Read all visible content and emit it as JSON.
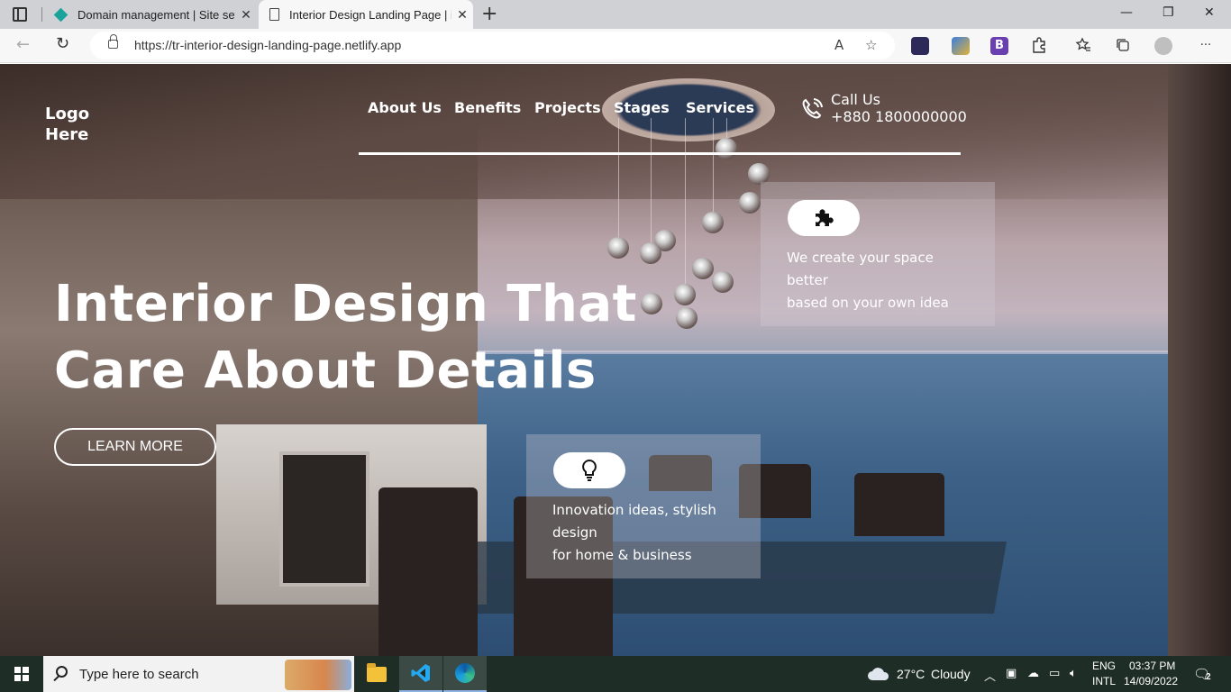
{
  "browser": {
    "tabs": [
      {
        "title": "Domain management | Site settin",
        "close": "✕"
      },
      {
        "title": "Interior Design Landing Page | iN",
        "close": "✕"
      }
    ],
    "new_tab": "+",
    "window_controls": {
      "minimize": "—",
      "restore": "❐",
      "close": "✕"
    },
    "back": "←",
    "reload": "↻",
    "url": "https://tr-interior-design-landing-page.netlify.app",
    "read_aloud": "A",
    "favorite": "☆",
    "more": "···",
    "extensions": {
      "b_label": "B"
    }
  },
  "site": {
    "logo_line1": "Logo",
    "logo_line2": "Here",
    "nav": [
      "About Us",
      "Benefits",
      "Projects",
      "Stages",
      "Services"
    ],
    "call_title": "Call Us",
    "call_number": "+880 1800000000",
    "hero_line1": "Interior Design That",
    "hero_line2": "Care About Details",
    "cta": "LEARN MORE",
    "cards": [
      {
        "icon": "puzzle-icon",
        "lines": [
          "We create your space",
          "better",
          "based on your own idea"
        ]
      },
      {
        "icon": "lightbulb-icon",
        "lines": [
          "Innovation ideas, stylish",
          "design",
          "for home & business"
        ]
      }
    ]
  },
  "taskbar": {
    "search_placeholder": "Type here to search",
    "weather_temp": "27°C",
    "weather_desc": "Cloudy",
    "lang1": "ENG",
    "lang2": "INTL",
    "time": "03:37 PM",
    "date": "14/09/2022",
    "notifications": "2"
  },
  "colors": {
    "taskbar_bg": "#1f2d27",
    "tab_active_bg": "#f7f7f7",
    "tabbar_bg": "#cfd1d4"
  }
}
